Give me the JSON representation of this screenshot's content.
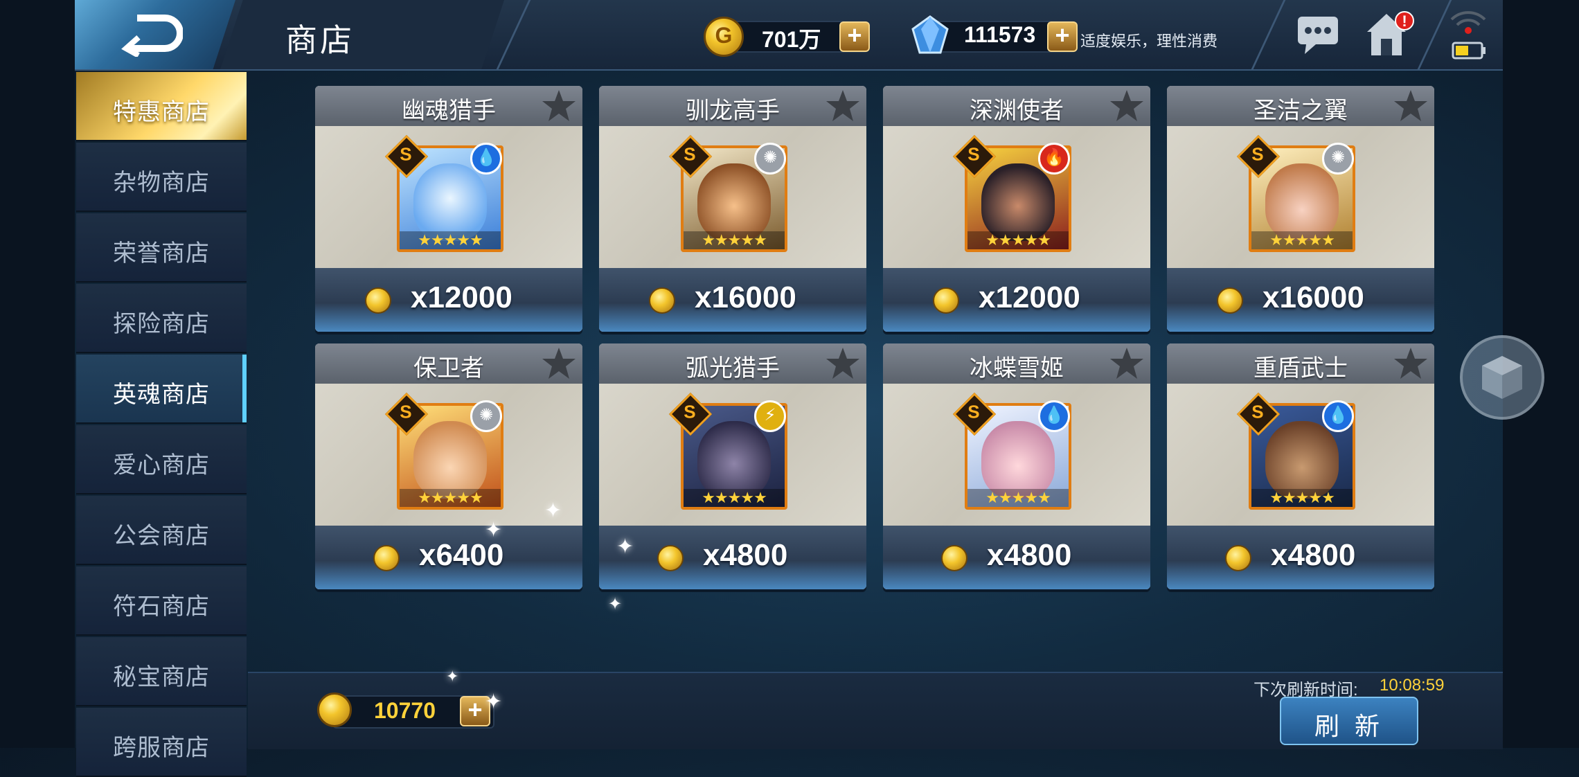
{
  "header": {
    "title": "商店",
    "gold_amount": "701万",
    "diamond_amount": "111573",
    "notice": "适度娱乐，理性消费"
  },
  "sidebar": {
    "items": [
      {
        "label": "特惠商店"
      },
      {
        "label": "杂物商店"
      },
      {
        "label": "荣誉商店"
      },
      {
        "label": "探险商店"
      },
      {
        "label": "英魂商店"
      },
      {
        "label": "爱心商店"
      },
      {
        "label": "公会商店"
      },
      {
        "label": "符石商店"
      },
      {
        "label": "秘宝商店"
      },
      {
        "label": "跨服商店"
      }
    ],
    "active_index": 4,
    "highlight_index": 0
  },
  "cards": [
    {
      "name": "幽魂猎手",
      "price": "x12000",
      "grade": "S",
      "element": "water-icon",
      "stars": "★★★★★"
    },
    {
      "name": "驯龙高手",
      "price": "x16000",
      "grade": "S",
      "element": "light-icon",
      "stars": "★★★★★"
    },
    {
      "name": "深渊使者",
      "price": "x12000",
      "grade": "S",
      "element": "fire-icon",
      "stars": "★★★★★"
    },
    {
      "name": "圣洁之翼",
      "price": "x16000",
      "grade": "S",
      "element": "light-icon",
      "stars": "★★★★★"
    },
    {
      "name": "保卫者",
      "price": "x6400",
      "grade": "S",
      "element": "light-icon",
      "stars": "★★★★★"
    },
    {
      "name": "弧光猎手",
      "price": "x4800",
      "grade": "S",
      "element": "lightning-icon",
      "stars": "★★★★★"
    },
    {
      "name": "冰蝶雪姬",
      "price": "x4800",
      "grade": "S",
      "element": "water-icon",
      "stars": "★★★★★"
    },
    {
      "name": "重盾武士",
      "price": "x4800",
      "grade": "S",
      "element": "water-icon",
      "stars": "★★★★★"
    }
  ],
  "footer": {
    "hero_soul_amount": "10770",
    "next_refresh_label": "下次刷新时间:",
    "next_refresh_time": "10:08:59",
    "refresh_button": "刷 新"
  },
  "colors": {
    "accent_gold": "#ffd23a",
    "active_tab_edge": "#5fd0ff",
    "portrait_frame": "#e07d12"
  }
}
